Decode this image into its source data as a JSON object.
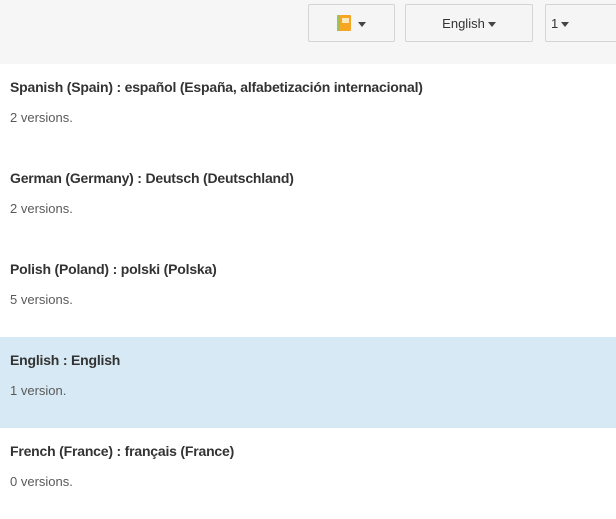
{
  "toolbar": {
    "ribbon_icon": "database-icon",
    "language_label": "English",
    "version_label": "1"
  },
  "languages": [
    {
      "title": "Spanish (Spain) : español (España, alfabetización internacional)",
      "versions": "2 versions.",
      "selected": false
    },
    {
      "title": "German (Germany) : Deutsch (Deutschland)",
      "versions": "2 versions.",
      "selected": false
    },
    {
      "title": "Polish (Poland) : polski (Polska)",
      "versions": "5 versions.",
      "selected": false
    },
    {
      "title": "English : English",
      "versions": "1 version.",
      "selected": true
    },
    {
      "title": "French (France) : français (France)",
      "versions": "0 versions.",
      "selected": false
    }
  ],
  "colors": {
    "selected_row": "#d6e9f4",
    "toolbar_bg": "#f6f6f6"
  }
}
